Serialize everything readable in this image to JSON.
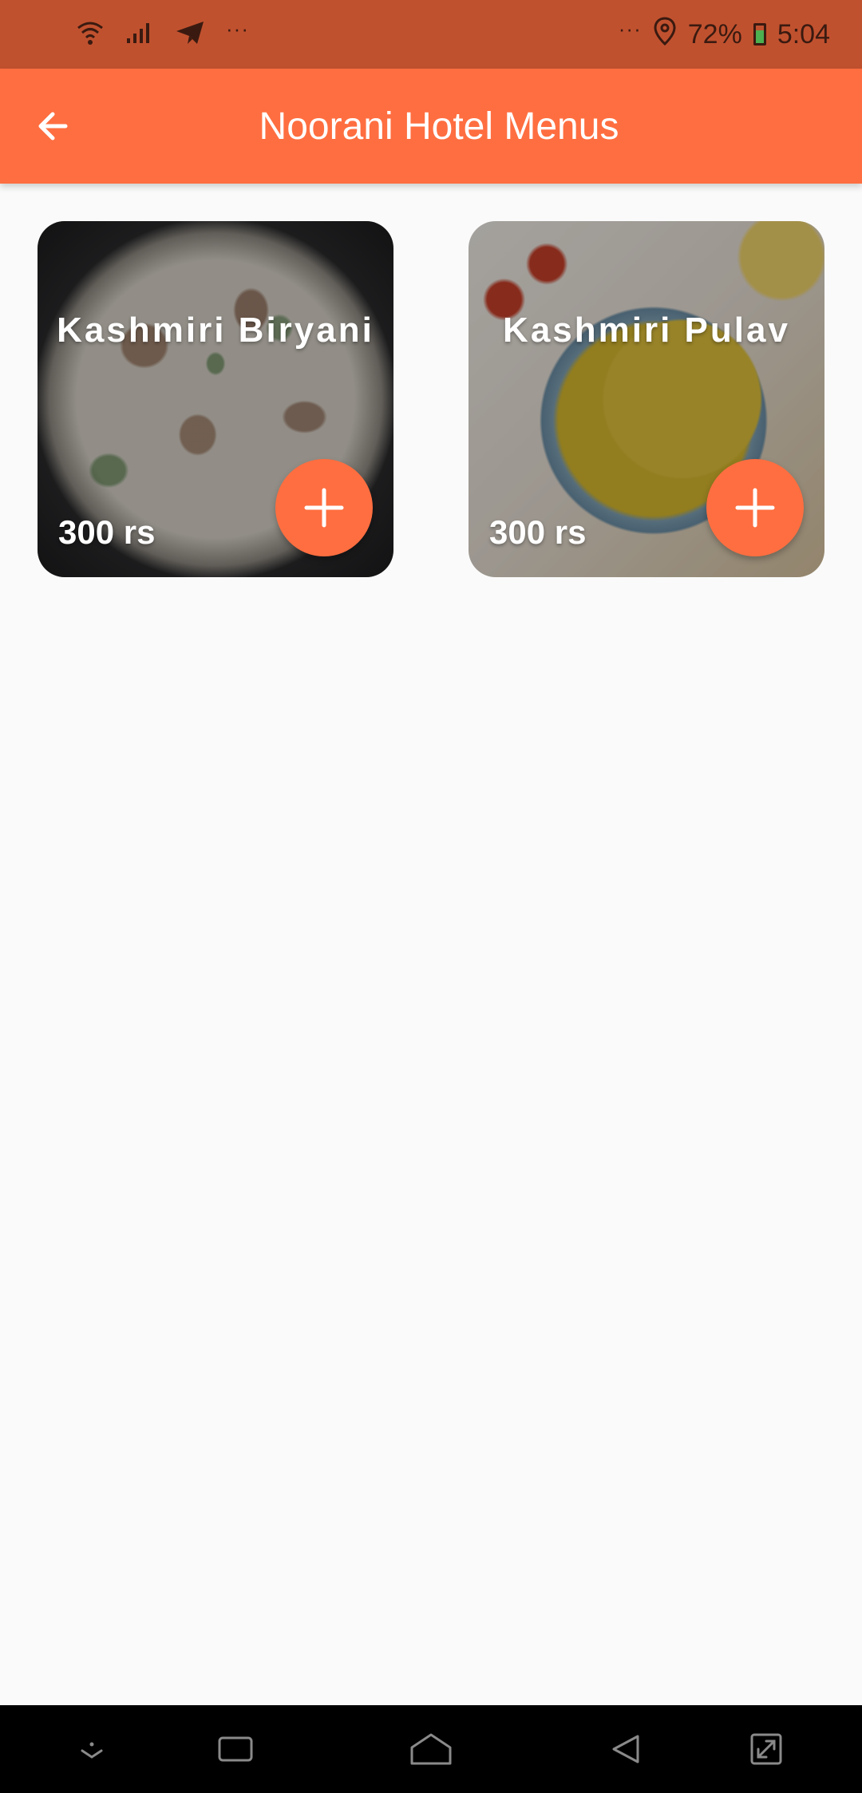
{
  "status_bar": {
    "left_dots": "···",
    "right_dots": "···",
    "battery": "72%",
    "time": "5:04",
    "icons": [
      "wifi-icon",
      "signal-icon",
      "telegram-icon",
      "location-icon",
      "battery-icon"
    ]
  },
  "app_bar": {
    "title": "Noorani Hotel Menus",
    "back_icon": "arrow-left-icon",
    "color": "#ff6e40"
  },
  "menu": {
    "items": [
      {
        "name": "Kashmiri Biryani",
        "price": "300 rs",
        "add_icon": "plus-icon"
      },
      {
        "name": "Kashmiri Pulav",
        "price": "300 rs",
        "add_icon": "plus-icon"
      }
    ]
  },
  "nav_bar": {
    "buttons": [
      "notification-down-icon",
      "recent-apps-icon",
      "home-icon",
      "back-triangle-icon",
      "rotate-screen-icon"
    ]
  },
  "colors": {
    "accent": "#ff6e40",
    "status_bar": "#c0512f",
    "background": "#fafafa"
  }
}
